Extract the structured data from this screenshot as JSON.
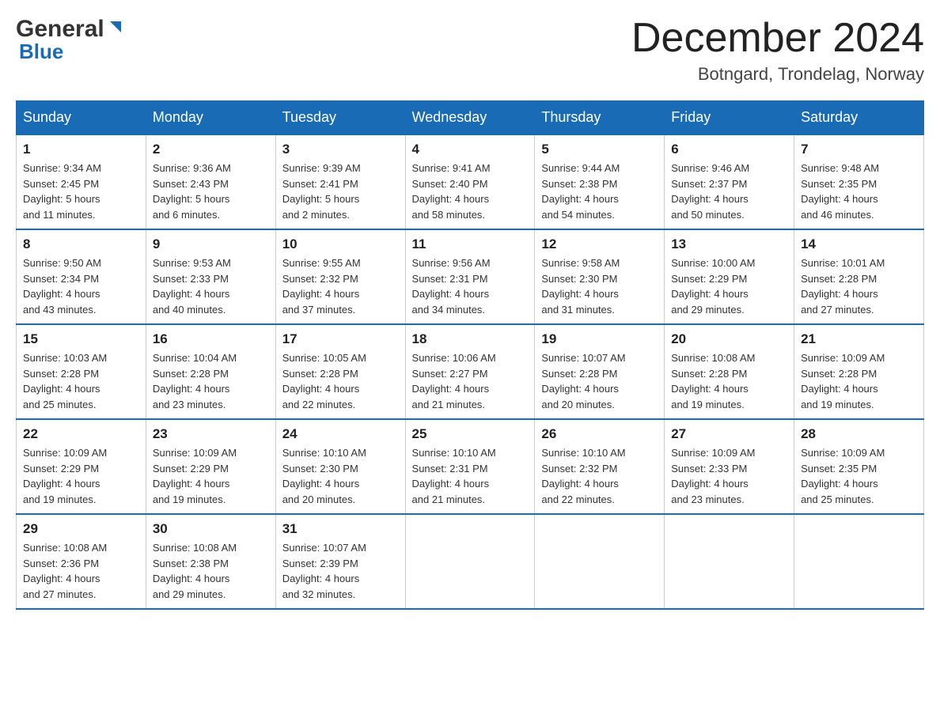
{
  "header": {
    "logo_general": "General",
    "logo_blue": "Blue",
    "month_title": "December 2024",
    "location": "Botngard, Trondelag, Norway"
  },
  "days_of_week": [
    "Sunday",
    "Monday",
    "Tuesday",
    "Wednesday",
    "Thursday",
    "Friday",
    "Saturday"
  ],
  "weeks": [
    [
      {
        "day": "1",
        "sunrise": "9:34 AM",
        "sunset": "2:45 PM",
        "daylight": "5 hours and 11 minutes."
      },
      {
        "day": "2",
        "sunrise": "9:36 AM",
        "sunset": "2:43 PM",
        "daylight": "5 hours and 6 minutes."
      },
      {
        "day": "3",
        "sunrise": "9:39 AM",
        "sunset": "2:41 PM",
        "daylight": "5 hours and 2 minutes."
      },
      {
        "day": "4",
        "sunrise": "9:41 AM",
        "sunset": "2:40 PM",
        "daylight": "4 hours and 58 minutes."
      },
      {
        "day": "5",
        "sunrise": "9:44 AM",
        "sunset": "2:38 PM",
        "daylight": "4 hours and 54 minutes."
      },
      {
        "day": "6",
        "sunrise": "9:46 AM",
        "sunset": "2:37 PM",
        "daylight": "4 hours and 50 minutes."
      },
      {
        "day": "7",
        "sunrise": "9:48 AM",
        "sunset": "2:35 PM",
        "daylight": "4 hours and 46 minutes."
      }
    ],
    [
      {
        "day": "8",
        "sunrise": "9:50 AM",
        "sunset": "2:34 PM",
        "daylight": "4 hours and 43 minutes."
      },
      {
        "day": "9",
        "sunrise": "9:53 AM",
        "sunset": "2:33 PM",
        "daylight": "4 hours and 40 minutes."
      },
      {
        "day": "10",
        "sunrise": "9:55 AM",
        "sunset": "2:32 PM",
        "daylight": "4 hours and 37 minutes."
      },
      {
        "day": "11",
        "sunrise": "9:56 AM",
        "sunset": "2:31 PM",
        "daylight": "4 hours and 34 minutes."
      },
      {
        "day": "12",
        "sunrise": "9:58 AM",
        "sunset": "2:30 PM",
        "daylight": "4 hours and 31 minutes."
      },
      {
        "day": "13",
        "sunrise": "10:00 AM",
        "sunset": "2:29 PM",
        "daylight": "4 hours and 29 minutes."
      },
      {
        "day": "14",
        "sunrise": "10:01 AM",
        "sunset": "2:28 PM",
        "daylight": "4 hours and 27 minutes."
      }
    ],
    [
      {
        "day": "15",
        "sunrise": "10:03 AM",
        "sunset": "2:28 PM",
        "daylight": "4 hours and 25 minutes."
      },
      {
        "day": "16",
        "sunrise": "10:04 AM",
        "sunset": "2:28 PM",
        "daylight": "4 hours and 23 minutes."
      },
      {
        "day": "17",
        "sunrise": "10:05 AM",
        "sunset": "2:28 PM",
        "daylight": "4 hours and 22 minutes."
      },
      {
        "day": "18",
        "sunrise": "10:06 AM",
        "sunset": "2:27 PM",
        "daylight": "4 hours and 21 minutes."
      },
      {
        "day": "19",
        "sunrise": "10:07 AM",
        "sunset": "2:28 PM",
        "daylight": "4 hours and 20 minutes."
      },
      {
        "day": "20",
        "sunrise": "10:08 AM",
        "sunset": "2:28 PM",
        "daylight": "4 hours and 19 minutes."
      },
      {
        "day": "21",
        "sunrise": "10:09 AM",
        "sunset": "2:28 PM",
        "daylight": "4 hours and 19 minutes."
      }
    ],
    [
      {
        "day": "22",
        "sunrise": "10:09 AM",
        "sunset": "2:29 PM",
        "daylight": "4 hours and 19 minutes."
      },
      {
        "day": "23",
        "sunrise": "10:09 AM",
        "sunset": "2:29 PM",
        "daylight": "4 hours and 19 minutes."
      },
      {
        "day": "24",
        "sunrise": "10:10 AM",
        "sunset": "2:30 PM",
        "daylight": "4 hours and 20 minutes."
      },
      {
        "day": "25",
        "sunrise": "10:10 AM",
        "sunset": "2:31 PM",
        "daylight": "4 hours and 21 minutes."
      },
      {
        "day": "26",
        "sunrise": "10:10 AM",
        "sunset": "2:32 PM",
        "daylight": "4 hours and 22 minutes."
      },
      {
        "day": "27",
        "sunrise": "10:09 AM",
        "sunset": "2:33 PM",
        "daylight": "4 hours and 23 minutes."
      },
      {
        "day": "28",
        "sunrise": "10:09 AM",
        "sunset": "2:35 PM",
        "daylight": "4 hours and 25 minutes."
      }
    ],
    [
      {
        "day": "29",
        "sunrise": "10:08 AM",
        "sunset": "2:36 PM",
        "daylight": "4 hours and 27 minutes."
      },
      {
        "day": "30",
        "sunrise": "10:08 AM",
        "sunset": "2:38 PM",
        "daylight": "4 hours and 29 minutes."
      },
      {
        "day": "31",
        "sunrise": "10:07 AM",
        "sunset": "2:39 PM",
        "daylight": "4 hours and 32 minutes."
      },
      null,
      null,
      null,
      null
    ]
  ],
  "labels": {
    "sunrise": "Sunrise:",
    "sunset": "Sunset:",
    "daylight": "Daylight:"
  }
}
